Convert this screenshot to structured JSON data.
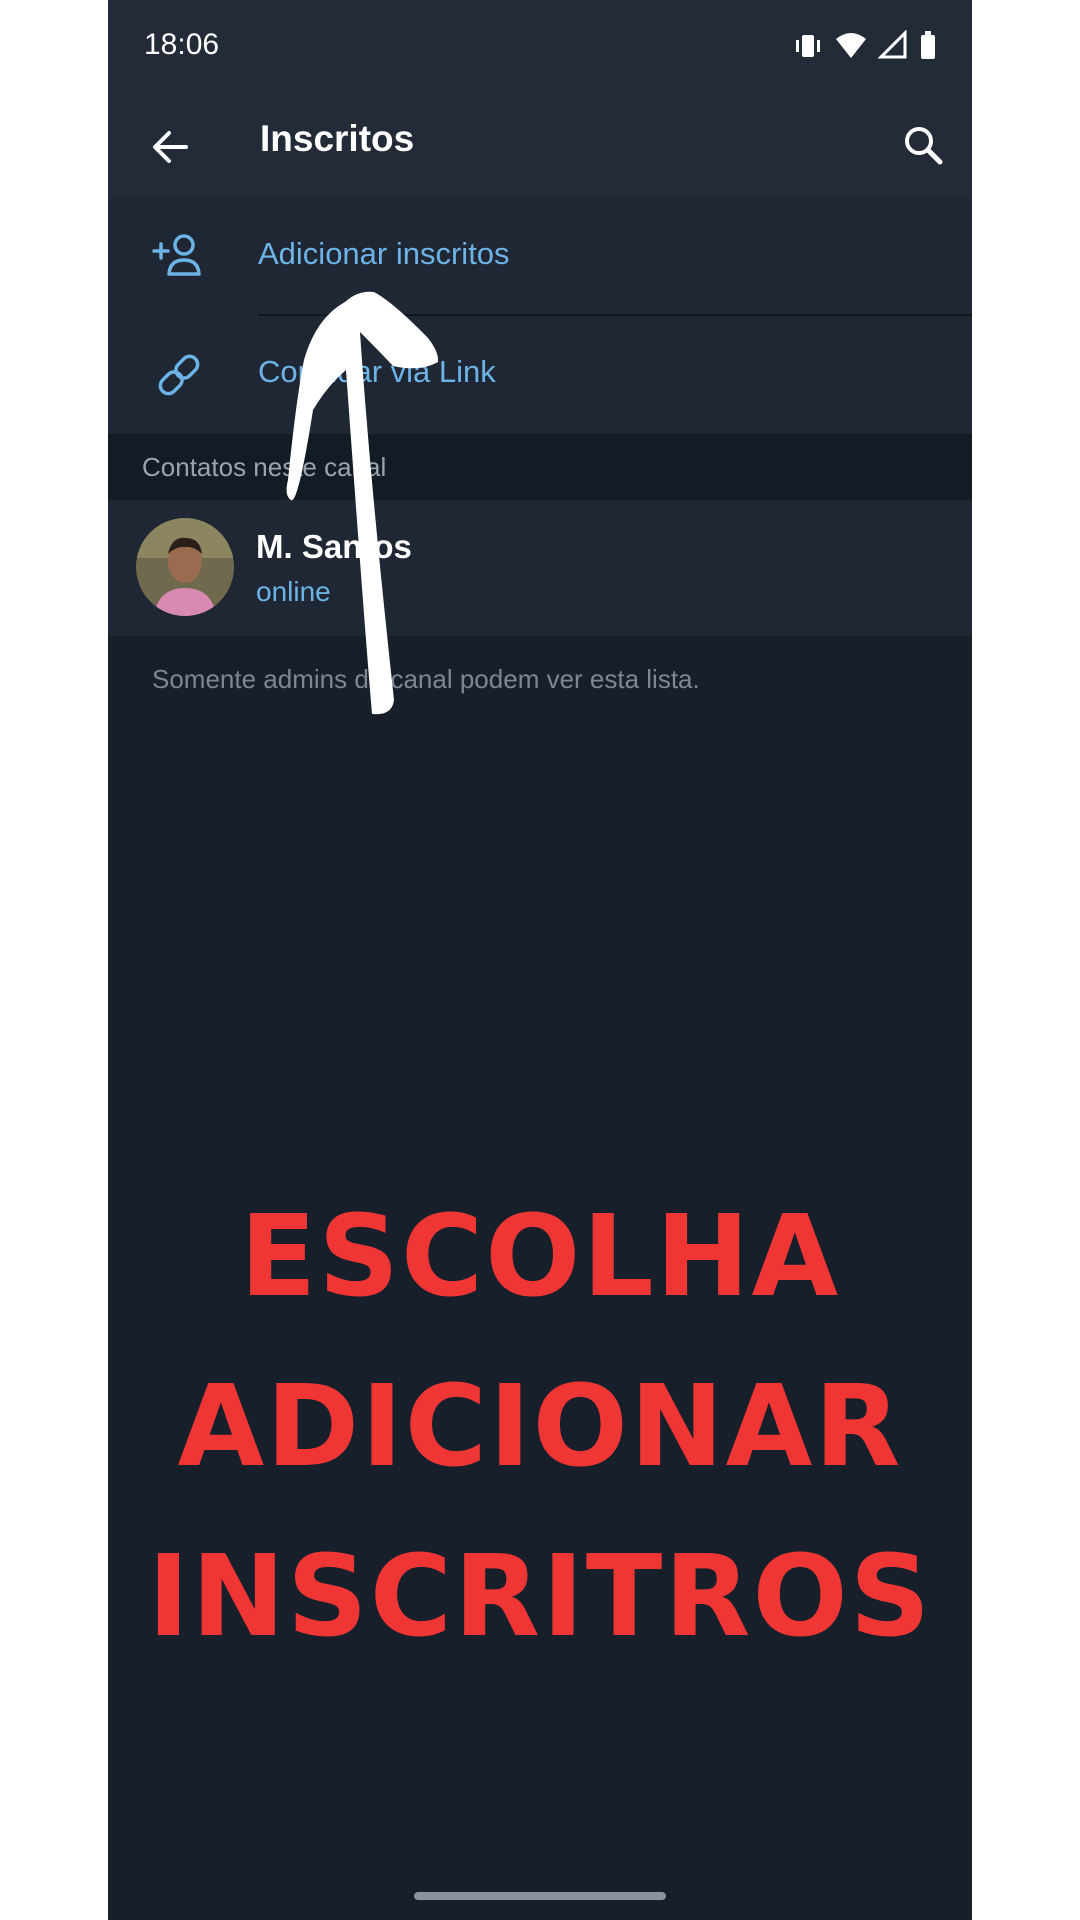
{
  "status_bar": {
    "time": "18:06",
    "icons": [
      "vibrate-icon",
      "wifi-icon",
      "signal-icon",
      "battery-icon"
    ]
  },
  "toolbar": {
    "title": "Inscritos",
    "back_icon": "arrow-left-icon",
    "search_icon": "search-icon"
  },
  "actions": [
    {
      "label": "Adicionar inscritos",
      "icon": "add-user-icon"
    },
    {
      "label": "Convidar via Link",
      "icon": "link-icon"
    }
  ],
  "section": {
    "title": "Contatos neste canal"
  },
  "contacts": [
    {
      "name": "M. Santos",
      "status": "online"
    }
  ],
  "footer_note": "Somente admins do canal podem ver esta lista.",
  "annotation": {
    "caption_lines": [
      "ESCOLHA",
      "ADICIONAR",
      "INSCRITROS"
    ],
    "caption_color": "#f03535",
    "arrow_color": "#ffffff"
  },
  "colors": {
    "background": "#17202a",
    "header": "#232b38",
    "accent": "#6db3e6"
  }
}
